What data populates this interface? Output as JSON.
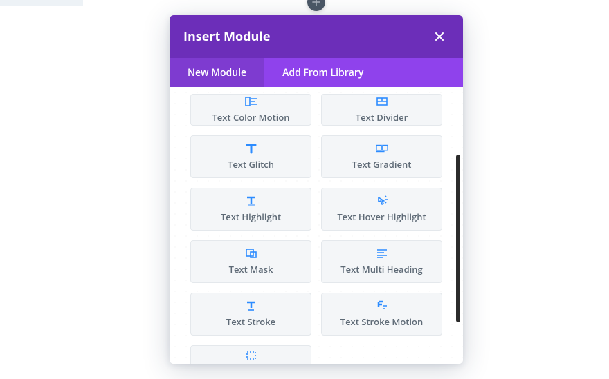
{
  "fab": {
    "aria": "add"
  },
  "modal": {
    "title": "Insert Module",
    "close_aria": "close"
  },
  "tabs": {
    "new": "New Module",
    "library": "Add From Library"
  },
  "modules": [
    {
      "id": "text-color-motion",
      "label": "Text Color Motion",
      "icon": "color-motion"
    },
    {
      "id": "text-divider",
      "label": "Text Divider",
      "icon": "divider"
    },
    {
      "id": "text-glitch",
      "label": "Text Glitch",
      "icon": "glitch"
    },
    {
      "id": "text-gradient",
      "label": "Text Gradient",
      "icon": "gradient"
    },
    {
      "id": "text-highlight",
      "label": "Text Highlight",
      "icon": "highlight"
    },
    {
      "id": "text-hover-highlight",
      "label": "Text Hover Highlight",
      "icon": "hover-highlight"
    },
    {
      "id": "text-mask",
      "label": "Text Mask",
      "icon": "mask"
    },
    {
      "id": "text-multi-heading",
      "label": "Text Multi Heading",
      "icon": "multi-heading"
    },
    {
      "id": "text-stroke",
      "label": "Text Stroke",
      "icon": "stroke"
    },
    {
      "id": "text-stroke-motion",
      "label": "Text Stroke Motion",
      "icon": "stroke-motion"
    },
    {
      "id": "text-next",
      "label": "",
      "icon": "next-partial"
    }
  ]
}
